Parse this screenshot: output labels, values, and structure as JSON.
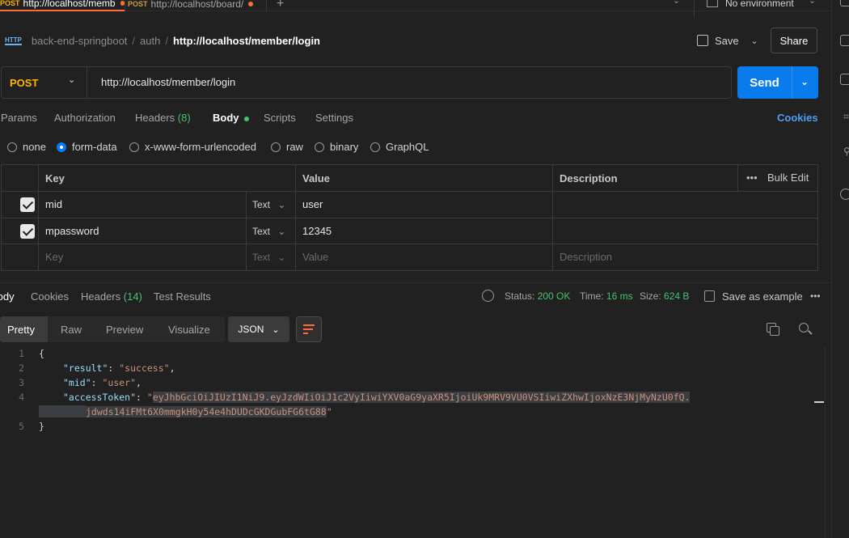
{
  "tabs": [
    {
      "method": "POST",
      "label": "http://localhost/memb",
      "unsaved": true
    },
    {
      "method": "POST",
      "label": "http://localhost/board/",
      "unsaved": true
    }
  ],
  "environment": "No environment",
  "breadcrumb": {
    "protocol_badge": "HTTP",
    "collection": "back-end-springboot",
    "folder": "auth",
    "request": "http://localhost/member/login",
    "separator": "/"
  },
  "actions": {
    "save": "Save",
    "share": "Share"
  },
  "request": {
    "method": "POST",
    "url": "http://localhost/member/login",
    "send": "Send"
  },
  "request_tabs": {
    "params": "Params",
    "authorization": "Authorization",
    "headers": "Headers",
    "headers_count": "(8)",
    "body": "Body",
    "scripts": "Scripts",
    "settings": "Settings",
    "cookies": "Cookies"
  },
  "body_types": {
    "selected": "form-data",
    "options": [
      "none",
      "form-data",
      "x-www-form-urlencoded",
      "raw",
      "binary",
      "GraphQL"
    ]
  },
  "params_table": {
    "headers": {
      "key": "Key",
      "value": "Value",
      "description": "Description",
      "bulk_edit": "Bulk Edit"
    },
    "rows": [
      {
        "checked": true,
        "key": "mid",
        "type": "Text",
        "value": "user"
      },
      {
        "checked": true,
        "key": "mpassword",
        "type": "Text",
        "value": "12345"
      }
    ],
    "placeholder": {
      "key": "Key",
      "type": "Text",
      "value": "Value",
      "description": "Description"
    }
  },
  "response_tabs": {
    "body": "Body",
    "cookies": "Cookies",
    "headers": "Headers",
    "headers_count": "(14)",
    "test_results": "Test Results"
  },
  "response_meta": {
    "status_label": "Status:",
    "status": "200 OK",
    "time_label": "Time:",
    "time": "16 ms",
    "size_label": "Size:",
    "size": "624 B",
    "save_example": "Save as example"
  },
  "view_tabs": [
    "Pretty",
    "Raw",
    "Preview",
    "Visualize"
  ],
  "format": "JSON",
  "code": {
    "line_numbers": [
      "1",
      "2",
      "3",
      "4",
      "5"
    ],
    "open_brace": "{",
    "close_brace": "}",
    "result_key": "\"result\"",
    "result_value": "\"success\"",
    "mid_key": "\"mid\"",
    "mid_value": "\"user\"",
    "token_key": "\"accessToken\"",
    "token_value_line1": "eyJhbGciOiJIUzI1NiJ9.eyJzdWIiOiJ1c2VyIiwiYXV0aG9yaXR5IjoiUk9MRV9VU0VSIiwiZXhwIjoxNzE3NjMyNzU0fQ.",
    "token_value_line2": "jdwds14iFMt6X0mmgkH0y54e4hDUDcGKDGubFG6tG88"
  },
  "colors": {
    "background": "#212121",
    "accent_send": "#097bed",
    "method_post": "#ffb400",
    "status_green": "#45c36b",
    "tab_indicator": "#ff6c37"
  }
}
